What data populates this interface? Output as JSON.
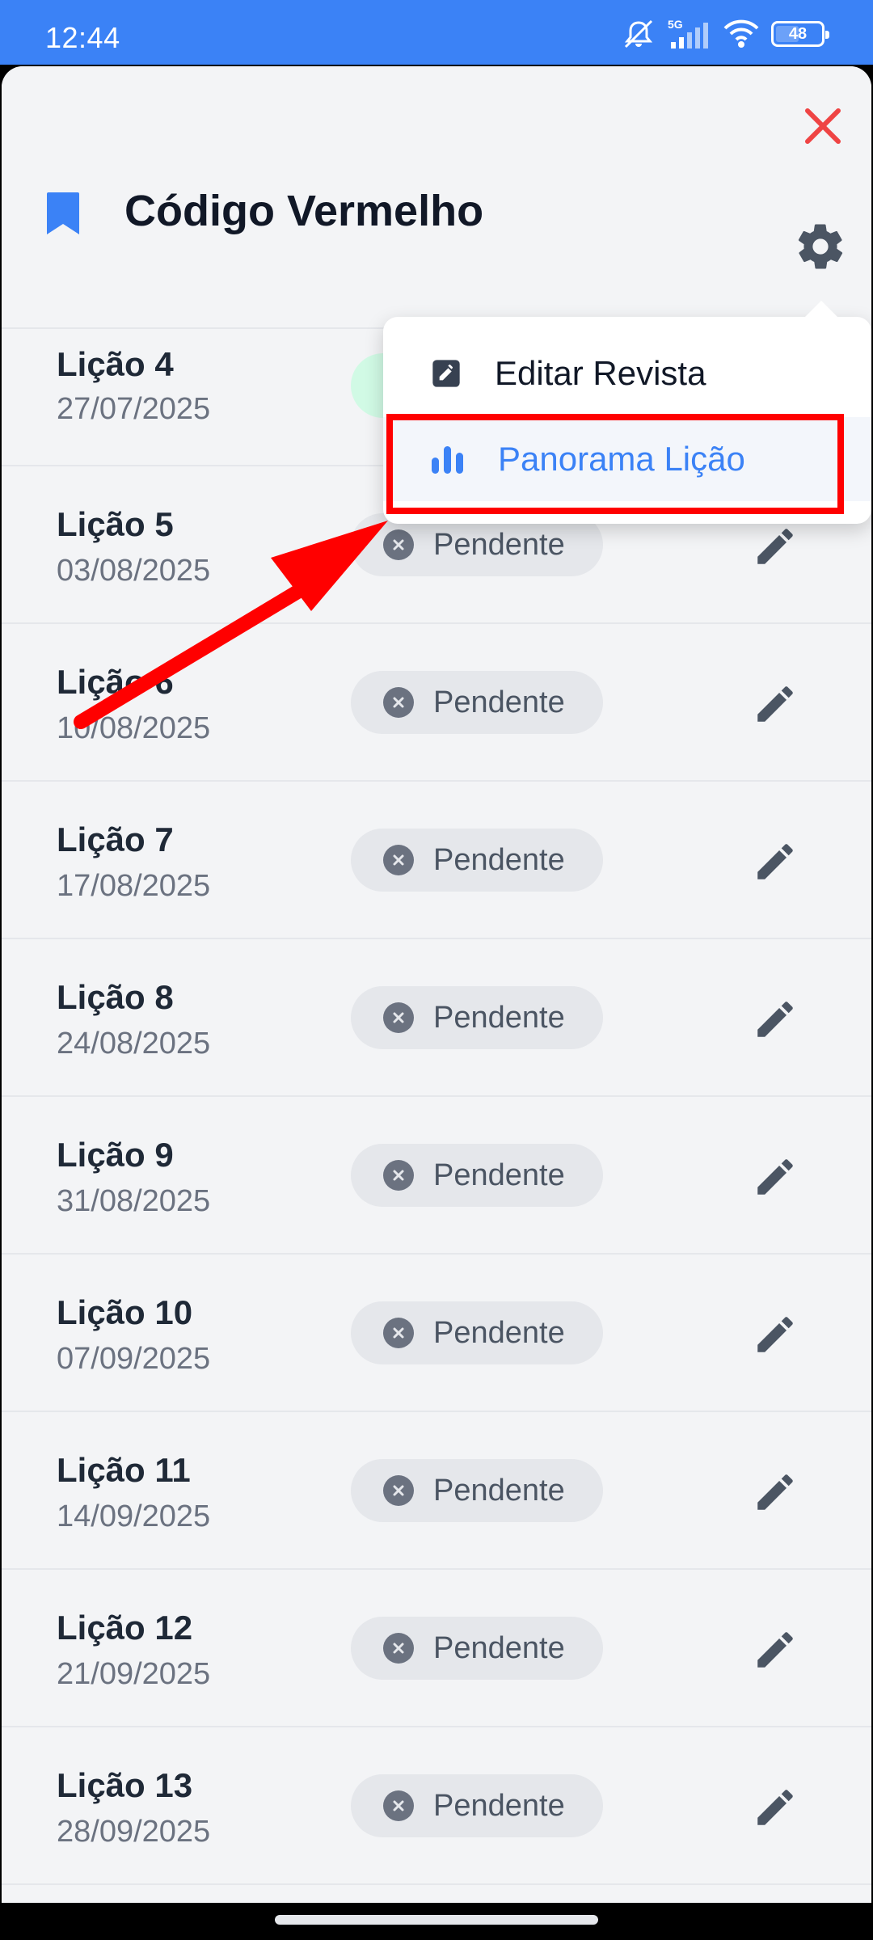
{
  "status_bar": {
    "time": "12:44",
    "network": "5G",
    "battery": "48",
    "icons": [
      "mute-icon",
      "signal-icon",
      "wifi-icon",
      "battery-icon"
    ]
  },
  "header": {
    "title": "Código Vermelho",
    "accent_color": "#3b82f6",
    "close_color": "#ef4444"
  },
  "menu": {
    "items": [
      {
        "label": "Editar Revista",
        "icon": "edit-icon"
      },
      {
        "label": "Panorama Lição",
        "icon": "bar-chart-icon"
      }
    ]
  },
  "lessons": [
    {
      "name": "Lição 4",
      "date": "27/07/2025",
      "status": ""
    },
    {
      "name": "Lição 5",
      "date": "03/08/2025",
      "status": "Pendente"
    },
    {
      "name": "Lição 6",
      "date": "10/08/2025",
      "status": "Pendente"
    },
    {
      "name": "Lição 7",
      "date": "17/08/2025",
      "status": "Pendente"
    },
    {
      "name": "Lição 8",
      "date": "24/08/2025",
      "status": "Pendente"
    },
    {
      "name": "Lição 9",
      "date": "31/08/2025",
      "status": "Pendente"
    },
    {
      "name": "Lição 10",
      "date": "07/09/2025",
      "status": "Pendente"
    },
    {
      "name": "Lição 11",
      "date": "14/09/2025",
      "status": "Pendente"
    },
    {
      "name": "Lição 12",
      "date": "21/09/2025",
      "status": "Pendente"
    },
    {
      "name": "Lição 13",
      "date": "28/09/2025",
      "status": "Pendente"
    }
  ]
}
